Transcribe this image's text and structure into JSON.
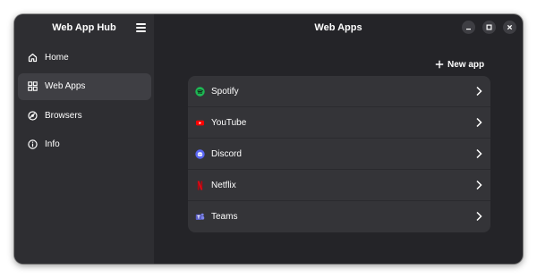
{
  "sidebar": {
    "title": "Web App Hub",
    "menu_icon": "hamburger-icon",
    "items": [
      {
        "label": "Home",
        "icon": "home-icon",
        "active": false
      },
      {
        "label": "Web Apps",
        "icon": "grid-icon",
        "active": true
      },
      {
        "label": "Browsers",
        "icon": "browser-icon",
        "active": false
      },
      {
        "label": "Info",
        "icon": "info-icon",
        "active": false
      }
    ]
  },
  "main": {
    "title": "Web Apps",
    "new_app_label": "New app",
    "apps": [
      {
        "name": "Spotify",
        "icon": "spotify-icon",
        "color": "#1db954"
      },
      {
        "name": "YouTube",
        "icon": "youtube-icon",
        "color": "#ff0000"
      },
      {
        "name": "Discord",
        "icon": "discord-icon",
        "color": "#5865f2"
      },
      {
        "name": "Netflix",
        "icon": "netflix-icon",
        "color": "#e50914"
      },
      {
        "name": "Teams",
        "icon": "teams-icon",
        "color": "#5b5fc7"
      }
    ]
  },
  "window_controls": [
    "minimize-icon",
    "maximize-icon",
    "close-icon"
  ],
  "colors": {
    "window_bg": "#242428",
    "sidebar_bg": "#2e2e32",
    "active_item_bg": "#3f3f44",
    "list_bg": "#343438",
    "text": "#ffffff"
  }
}
